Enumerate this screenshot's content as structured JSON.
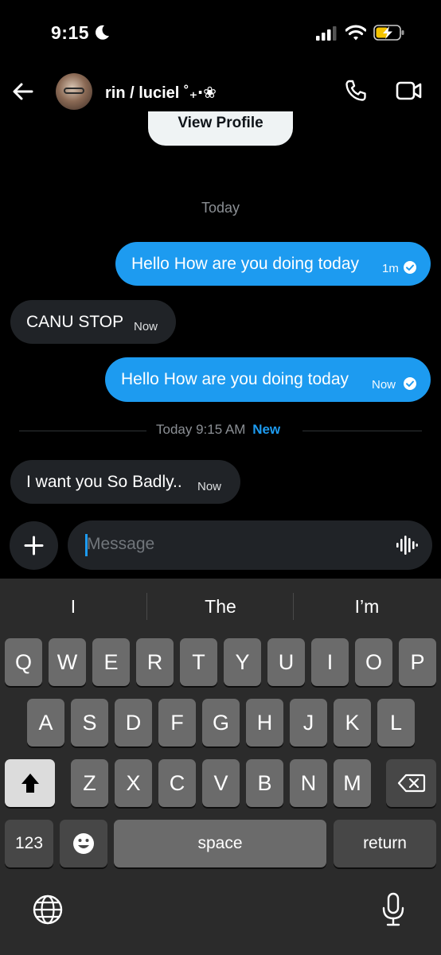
{
  "status_bar": {
    "time": "9:15"
  },
  "header": {
    "contact_name": "rin / luciel ˚₊‧❀"
  },
  "view_profile": "View Profile",
  "day_label": "Today",
  "messages": [
    {
      "direction": "out",
      "text": "Hello How are you doing today",
      "time": "1m",
      "read": true
    },
    {
      "direction": "in",
      "text": "CANU STOP",
      "time": "Now"
    },
    {
      "direction": "out",
      "text": "Hello How are you doing today",
      "time": "Now",
      "read": true
    },
    {
      "direction": "in",
      "text": "I want you So Badly..",
      "time": "Now"
    }
  ],
  "divider": {
    "text": "Today 9:15 AM",
    "badge": "New"
  },
  "composer": {
    "placeholder": "Message"
  },
  "keyboard": {
    "suggestions": [
      "I",
      "The",
      "I’m"
    ],
    "row1": [
      "Q",
      "W",
      "E",
      "R",
      "T",
      "Y",
      "U",
      "I",
      "O",
      "P"
    ],
    "row2": [
      "A",
      "S",
      "D",
      "F",
      "G",
      "H",
      "J",
      "K",
      "L"
    ],
    "row3": [
      "Z",
      "X",
      "C",
      "V",
      "B",
      "N",
      "M"
    ],
    "numbers_label": "123",
    "space_label": "space",
    "return_label": "return"
  },
  "colors": {
    "accent": "#1d9bf0",
    "incoming_bubble": "#202327",
    "background": "#000000"
  }
}
